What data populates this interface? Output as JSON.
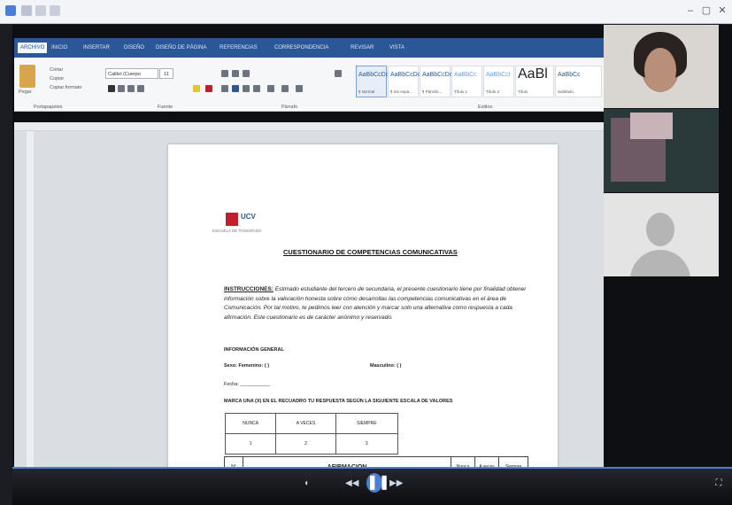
{
  "window": {
    "controls": [
      "–",
      "▢",
      "✕"
    ]
  },
  "ribbon": {
    "tabs": [
      "ARCHIVO",
      "INICIO",
      "INSERTAR",
      "DISEÑO",
      "DISEÑO DE PÁGINA",
      "REFERENCIAS",
      "CORRESPONDENCIA",
      "REVISAR",
      "VISTA"
    ],
    "active_tab": "INICIO",
    "clipboard": {
      "paste_label": "Pegar",
      "cut_label": "Cortar",
      "copy_label": "Copiar",
      "format_label": "Copiar formato",
      "group_label": "Portapapeles"
    },
    "font": {
      "family": "Calibri (Cuerpo",
      "size": "11",
      "group_label": "Fuente"
    },
    "paragraph": {
      "group_label": "Párrafo"
    },
    "styles": {
      "group_label": "Estilos",
      "items": [
        {
          "sample": "AaBbCcDc",
          "name": "¶ Normal"
        },
        {
          "sample": "AaBbCcDc",
          "name": "¶ Sin espa..."
        },
        {
          "sample": "AaBbCcDc",
          "name": "¶ Párrafo..."
        },
        {
          "sample": "AaBbCc",
          "name": "Título 1"
        },
        {
          "sample": "AaBbCcI",
          "name": "Título 2"
        },
        {
          "sample": "AaBl",
          "name": "Título"
        },
        {
          "sample": "AaBbCc",
          "name": "Subtítulo"
        }
      ]
    }
  },
  "document": {
    "logo_text": "UCV",
    "logo_sub": "ESCUELA DE POSGRADO",
    "title": "CUESTIONARIO DE  COMPETENCIAS COMUNICATIVAS",
    "instructions_label": "INSTRUCCIONES:",
    "instructions": " Estimado estudiante del tercero de secundaria, el presente cuestionario tiene por finalidad obtener información sobre la valoración honesta sobre cómo desarrollas las competencias comunicativas en el área de Comunicación. Por tal motivo, te pedimos leer con atención y marcar solo una alternativa como respuesta a cada afirmación. Este cuestionario es de carácter anónimo y reservado.",
    "general_info": "INFORMACIÓN GENERAL",
    "female_label": "Sexo: Femenino:  (   )",
    "male_label": "Masculino:  (   )",
    "date_label": "Fecha: ___________",
    "mark_instruction": "MARCA UNA (X) EN EL RECUADRO TU RESPUESTA  SEGÚN LA  SIGUIENTE ESCALA DE VALORES",
    "scale": {
      "headers": [
        "NUNCA",
        "A VECES",
        "SIEMPRE"
      ],
      "values": [
        "1",
        "2",
        "3"
      ]
    },
    "affirmation_table": {
      "headers": [
        "N°",
        "AFIRMACION",
        "Nunca",
        "A veces",
        "Siempre"
      ]
    }
  },
  "player": {
    "play_icon": "pause",
    "progress": 0.02
  }
}
